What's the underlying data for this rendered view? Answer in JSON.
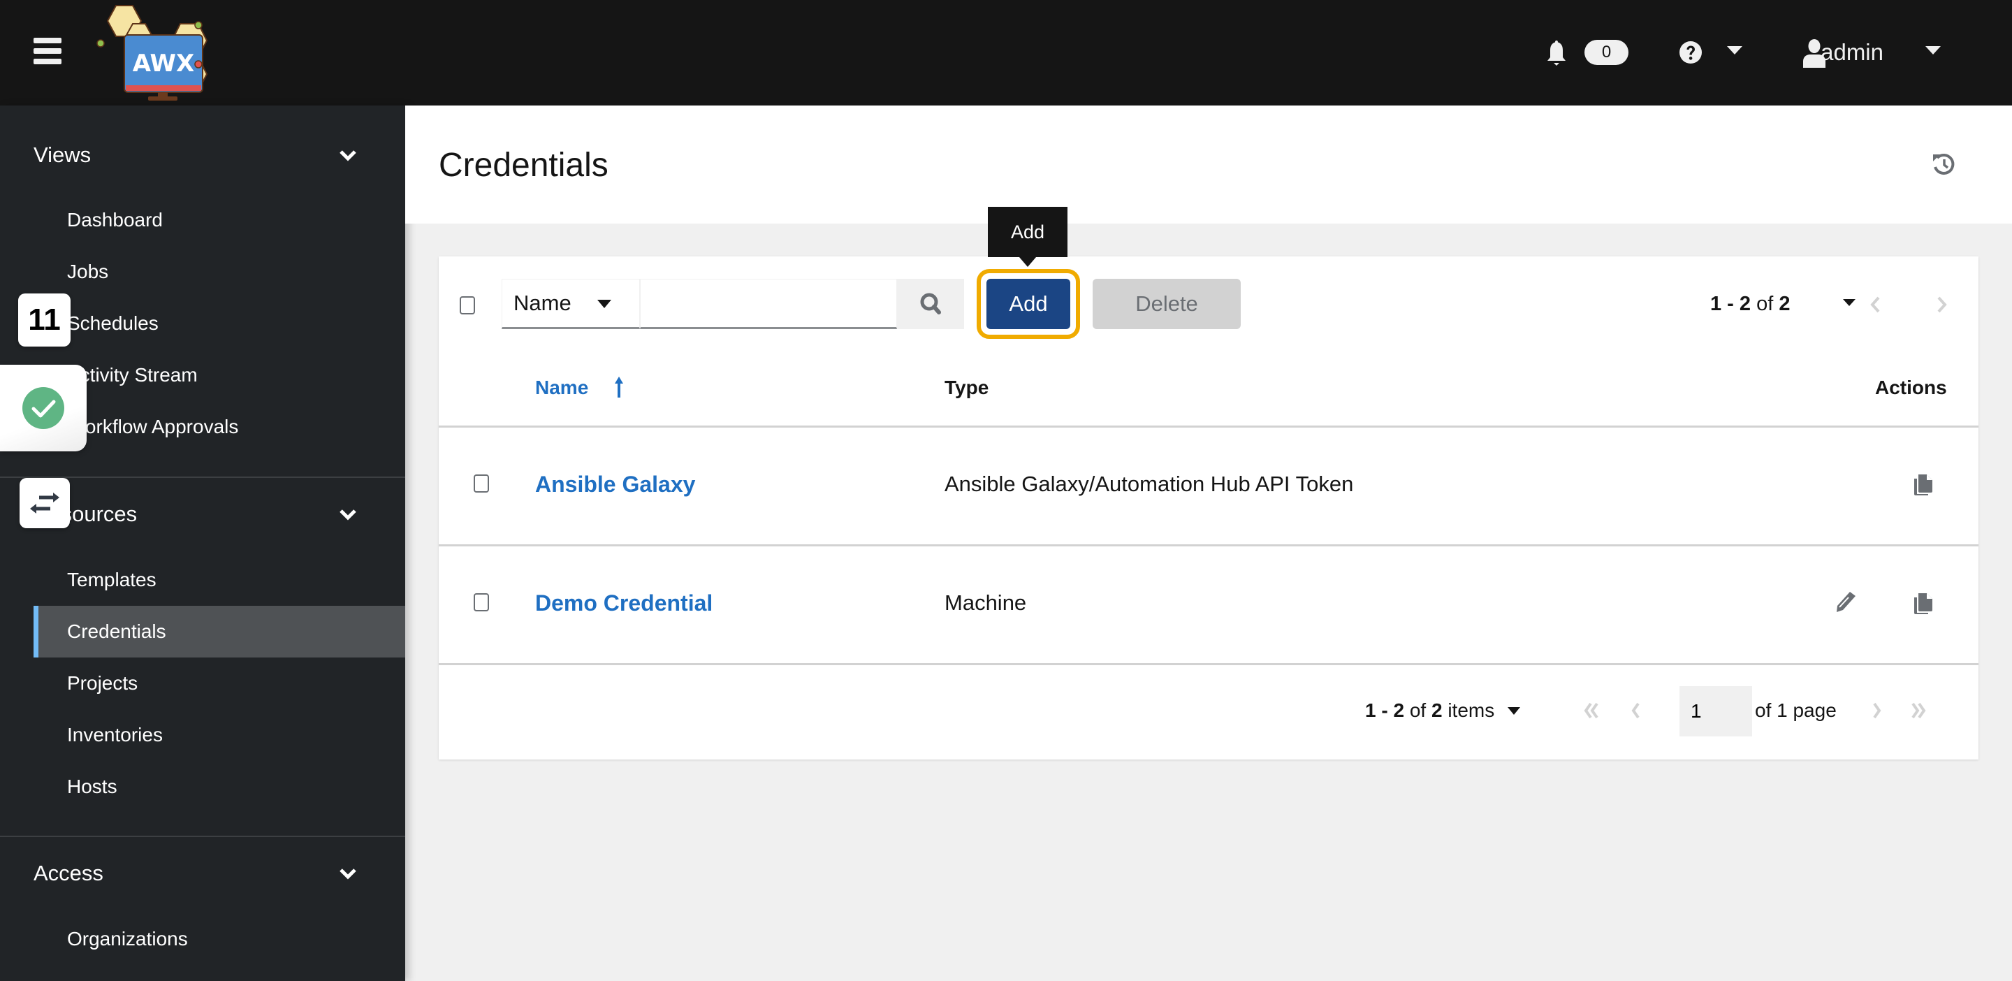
{
  "header": {
    "app_name": "AWX",
    "notifications_count": "0",
    "user_name": "admin",
    "icons": {
      "menu": "hamburger-icon",
      "notifications": "bell-icon",
      "help": "question-circle-icon",
      "user": "user-icon"
    }
  },
  "sidebar": {
    "sections": [
      {
        "title": "Views",
        "items": [
          "Dashboard",
          "Jobs",
          "Schedules",
          "Activity Stream",
          "Workflow Approvals"
        ]
      },
      {
        "title": "Resources",
        "items": [
          "Templates",
          "Credentials",
          "Projects",
          "Inventories",
          "Hosts"
        ]
      },
      {
        "title": "Access",
        "items": [
          "Organizations"
        ]
      }
    ],
    "active_item": "Credentials",
    "accent_color": "#73bcf7"
  },
  "overlays": {
    "count_badge": "11",
    "status_icon": "check-circle-icon",
    "swap_icon": "swap-arrows-icon"
  },
  "page": {
    "title": "Credentials",
    "history_icon": "history-icon"
  },
  "toolbar": {
    "filter_field": "Name",
    "search_value": "",
    "search_placeholder": "",
    "add_label": "Add",
    "delete_label": "Delete",
    "tooltip": "Add",
    "pager_range": "1 - 2",
    "pager_of": "of",
    "pager_total": "2"
  },
  "table": {
    "columns": [
      "Name",
      "Type",
      "Actions"
    ],
    "sort_column": "Name",
    "sort_direction": "ascending",
    "rows": [
      {
        "name": "Ansible Galaxy",
        "type": "Ansible Galaxy/Automation Hub API Token",
        "actions": [
          "copy"
        ]
      },
      {
        "name": "Demo Credential",
        "type": "Machine",
        "actions": [
          "edit",
          "copy"
        ]
      }
    ]
  },
  "footer": {
    "range": "1 - 2",
    "of": "of",
    "total": "2",
    "items_label": "items",
    "page_value": "1",
    "page_of_label": "of 1 page"
  },
  "colors": {
    "primary": "#1b4584",
    "link": "#1f6fc2",
    "focus_ring": "#f0ab00",
    "header_bg": "#151515",
    "sidebar_bg": "#212427",
    "success": "#5fb584"
  }
}
